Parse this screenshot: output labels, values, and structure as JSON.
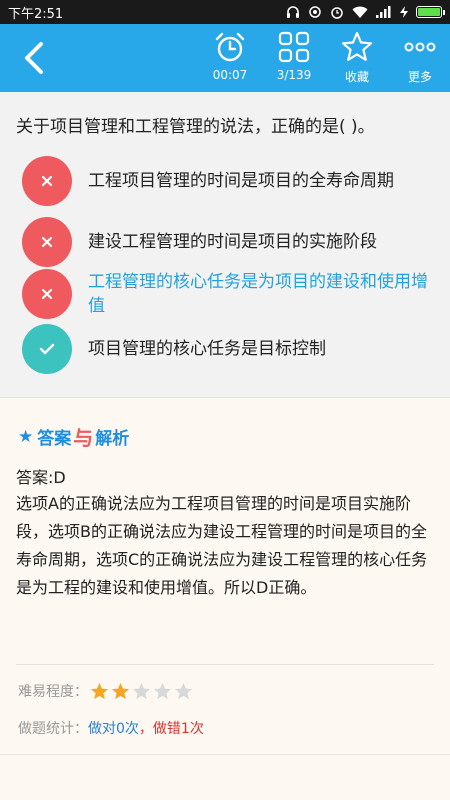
{
  "status_bar": {
    "time": "下午2:51",
    "battery_color": "#5ee04a"
  },
  "toolbar": {
    "back_icon": "chevron-left-icon",
    "tools": [
      {
        "icon": "alarm-clock-icon",
        "label": "00:07"
      },
      {
        "icon": "grid-icon",
        "label": "3/139"
      },
      {
        "icon": "star-outline-icon",
        "label": "收藏"
      },
      {
        "icon": "more-dots-icon",
        "label": "更多"
      }
    ],
    "bg_color": "#28a8e8"
  },
  "question": {
    "stem": "关于项目管理和工程管理的说法，正确的是(   )。",
    "options": [
      {
        "text": "工程项目管理的时间是项目的全寿命周期",
        "state": "wrong",
        "chosen": false
      },
      {
        "text": "建设工程管理的时间是项目的实施阶段",
        "state": "wrong",
        "chosen": false
      },
      {
        "text": "工程管理的核心任务是为项目的建设和使用增值",
        "state": "wrong",
        "chosen": true
      },
      {
        "text": "项目管理的核心任务是目标控制",
        "state": "right",
        "chosen": false
      }
    ]
  },
  "analysis": {
    "title_left": "答案",
    "title_mid": "与",
    "title_right": "解析",
    "answer": "答案:D",
    "explanation": "选项A的正确说法应为工程项目管理的时间是项目实施阶段，选项B的正确说法应为建设工程管理的时间是项目的全寿命周期，选项C的正确说法应为建设工程管理的核心任务是为工程的建设和使用增值。所以D正确。",
    "difficulty_label": "难易程度：",
    "difficulty_stars": 2,
    "difficulty_max": 5,
    "stats_label": "做题统计：",
    "stats_right": "做对0次",
    "stats_sep": "，",
    "stats_wrong": "做错1次"
  }
}
